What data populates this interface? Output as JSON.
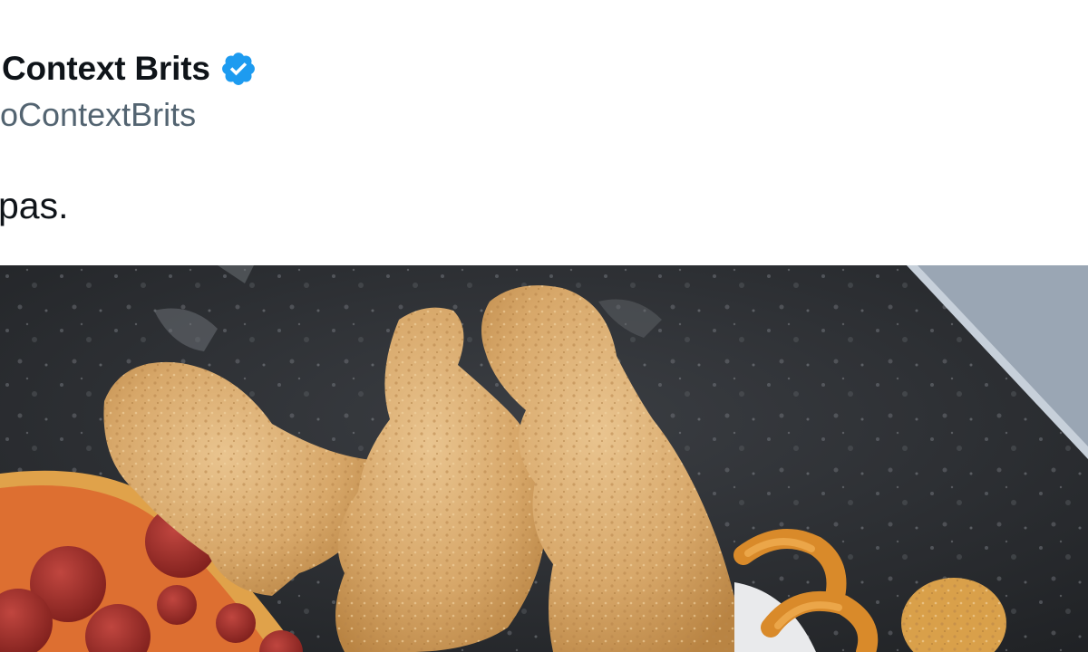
{
  "tweet": {
    "author": {
      "display_name": "Context Brits",
      "handle": "oContextBrits",
      "verified_icon": "verified-badge-icon"
    },
    "text": "pas.",
    "media": {
      "type": "photo",
      "icon": "food-photo"
    }
  },
  "colors": {
    "name": "#0f1419",
    "handle": "#536471",
    "verified": "#1d9bf0"
  }
}
